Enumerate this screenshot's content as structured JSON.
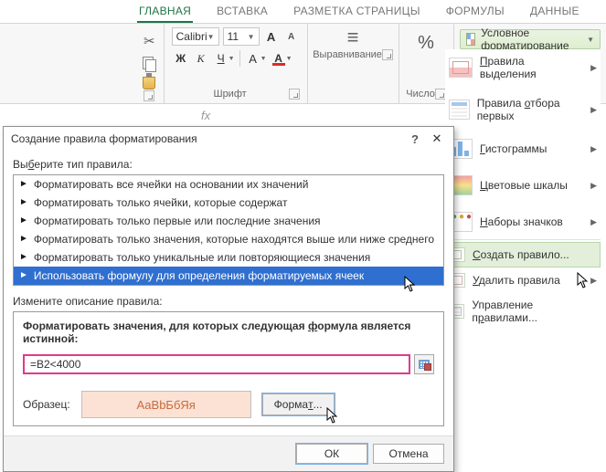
{
  "ribbon": {
    "tabs": [
      "ГЛАВНАЯ",
      "ВСТАВКА",
      "РАЗМЕТКА СТРАНИЦЫ",
      "ФОРМУЛЫ",
      "ДАННЫЕ"
    ],
    "font": {
      "name": "Calibri",
      "size": "11",
      "bold": "Ж",
      "italic": "К",
      "underline": "Ч",
      "color_letter": "A",
      "group_title": "Шрифт"
    },
    "align_label": "Выравнивание",
    "number_label": "Число",
    "percent": "%",
    "cond_fmt_label": "Условное форматирование"
  },
  "cf_menu": {
    "items": [
      {
        "label_pre": "",
        "label_u": "П",
        "label_post": "равила выделения"
      },
      {
        "label_pre": "Правила ",
        "label_u": "о",
        "label_post": "тбора первых"
      },
      {
        "label_pre": "",
        "label_u": "Г",
        "label_post": "истограммы"
      },
      {
        "label_pre": "",
        "label_u": "Ц",
        "label_post": "ветовые шкалы"
      },
      {
        "label_pre": "",
        "label_u": "Н",
        "label_post": "аборы значков"
      },
      {
        "label_pre": "",
        "label_u": "С",
        "label_post": "оздать правило..."
      },
      {
        "label_pre": "",
        "label_u": "У",
        "label_post": "далить правила"
      },
      {
        "label_pre": "Управление п",
        "label_u": "р",
        "label_post": "авилами..."
      }
    ]
  },
  "dialog": {
    "title": "Создание правила форматирования",
    "select_label_pre": "Вы",
    "select_label_u": "б",
    "select_label_post": "ерите тип правила:",
    "rules": [
      "Форматировать все ячейки на основании их значений",
      "Форматировать только ячейки, которые содержат",
      "Форматировать только первые или последние значения",
      "Форматировать только значения, которые находятся выше или ниже среднего",
      "Форматировать только уникальные или повторяющиеся значения",
      "Использовать формулу для определения форматируемых ячеек"
    ],
    "edit_label": "Измените описание правила:",
    "formula_label_pre": "Форматировать значения, для которых следующая ",
    "formula_label_u": "ф",
    "formula_label_post": "ормула является истинной:",
    "formula_value": "=B2<4000",
    "sample_label": "Образец:",
    "sample_text": "АаВbБбЯя",
    "format_btn_pre": "Форма",
    "format_btn_u": "т",
    "format_btn_post": "...",
    "ok": "ОК",
    "cancel": "Отмена"
  },
  "fx_label": "fx"
}
